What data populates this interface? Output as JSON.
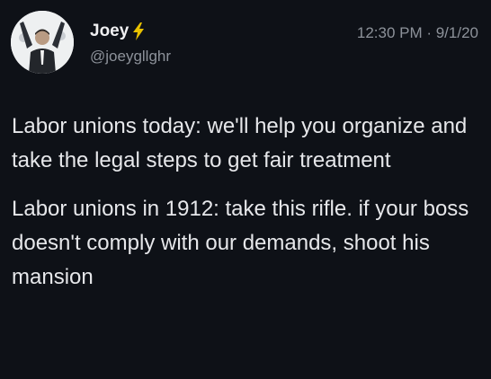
{
  "author": {
    "display_name": "Joey",
    "badge_icon": "lightning-bolt-icon",
    "handle": "@joeygllghr"
  },
  "timestamp": "12:30 PM · 9/1/20",
  "tweet_text": {
    "paragraph_1": "Labor unions today: we'll help you organize and take the legal steps to get fair treatment",
    "paragraph_2": "Labor unions in 1912: take this rifle. if your boss doesn't comply with our demands, shoot his mansion"
  },
  "colors": {
    "background": "#0e1117",
    "text": "#e6e7ea",
    "secondary_text": "#8d929a",
    "badge": "#e8c100"
  }
}
